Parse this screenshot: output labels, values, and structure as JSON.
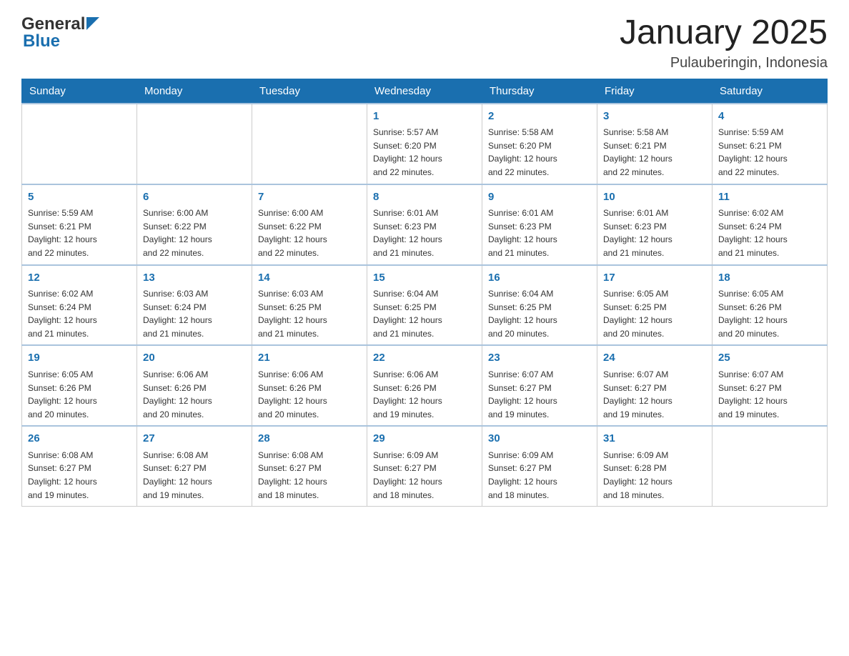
{
  "header": {
    "logo_general": "General",
    "logo_blue": "Blue",
    "title": "January 2025",
    "subtitle": "Pulauberingin, Indonesia"
  },
  "days_of_week": [
    "Sunday",
    "Monday",
    "Tuesday",
    "Wednesday",
    "Thursday",
    "Friday",
    "Saturday"
  ],
  "weeks": [
    [
      {
        "day": "",
        "info": ""
      },
      {
        "day": "",
        "info": ""
      },
      {
        "day": "",
        "info": ""
      },
      {
        "day": "1",
        "info": "Sunrise: 5:57 AM\nSunset: 6:20 PM\nDaylight: 12 hours\nand 22 minutes."
      },
      {
        "day": "2",
        "info": "Sunrise: 5:58 AM\nSunset: 6:20 PM\nDaylight: 12 hours\nand 22 minutes."
      },
      {
        "day": "3",
        "info": "Sunrise: 5:58 AM\nSunset: 6:21 PM\nDaylight: 12 hours\nand 22 minutes."
      },
      {
        "day": "4",
        "info": "Sunrise: 5:59 AM\nSunset: 6:21 PM\nDaylight: 12 hours\nand 22 minutes."
      }
    ],
    [
      {
        "day": "5",
        "info": "Sunrise: 5:59 AM\nSunset: 6:21 PM\nDaylight: 12 hours\nand 22 minutes."
      },
      {
        "day": "6",
        "info": "Sunrise: 6:00 AM\nSunset: 6:22 PM\nDaylight: 12 hours\nand 22 minutes."
      },
      {
        "day": "7",
        "info": "Sunrise: 6:00 AM\nSunset: 6:22 PM\nDaylight: 12 hours\nand 22 minutes."
      },
      {
        "day": "8",
        "info": "Sunrise: 6:01 AM\nSunset: 6:23 PM\nDaylight: 12 hours\nand 21 minutes."
      },
      {
        "day": "9",
        "info": "Sunrise: 6:01 AM\nSunset: 6:23 PM\nDaylight: 12 hours\nand 21 minutes."
      },
      {
        "day": "10",
        "info": "Sunrise: 6:01 AM\nSunset: 6:23 PM\nDaylight: 12 hours\nand 21 minutes."
      },
      {
        "day": "11",
        "info": "Sunrise: 6:02 AM\nSunset: 6:24 PM\nDaylight: 12 hours\nand 21 minutes."
      }
    ],
    [
      {
        "day": "12",
        "info": "Sunrise: 6:02 AM\nSunset: 6:24 PM\nDaylight: 12 hours\nand 21 minutes."
      },
      {
        "day": "13",
        "info": "Sunrise: 6:03 AM\nSunset: 6:24 PM\nDaylight: 12 hours\nand 21 minutes."
      },
      {
        "day": "14",
        "info": "Sunrise: 6:03 AM\nSunset: 6:25 PM\nDaylight: 12 hours\nand 21 minutes."
      },
      {
        "day": "15",
        "info": "Sunrise: 6:04 AM\nSunset: 6:25 PM\nDaylight: 12 hours\nand 21 minutes."
      },
      {
        "day": "16",
        "info": "Sunrise: 6:04 AM\nSunset: 6:25 PM\nDaylight: 12 hours\nand 20 minutes."
      },
      {
        "day": "17",
        "info": "Sunrise: 6:05 AM\nSunset: 6:25 PM\nDaylight: 12 hours\nand 20 minutes."
      },
      {
        "day": "18",
        "info": "Sunrise: 6:05 AM\nSunset: 6:26 PM\nDaylight: 12 hours\nand 20 minutes."
      }
    ],
    [
      {
        "day": "19",
        "info": "Sunrise: 6:05 AM\nSunset: 6:26 PM\nDaylight: 12 hours\nand 20 minutes."
      },
      {
        "day": "20",
        "info": "Sunrise: 6:06 AM\nSunset: 6:26 PM\nDaylight: 12 hours\nand 20 minutes."
      },
      {
        "day": "21",
        "info": "Sunrise: 6:06 AM\nSunset: 6:26 PM\nDaylight: 12 hours\nand 20 minutes."
      },
      {
        "day": "22",
        "info": "Sunrise: 6:06 AM\nSunset: 6:26 PM\nDaylight: 12 hours\nand 19 minutes."
      },
      {
        "day": "23",
        "info": "Sunrise: 6:07 AM\nSunset: 6:27 PM\nDaylight: 12 hours\nand 19 minutes."
      },
      {
        "day": "24",
        "info": "Sunrise: 6:07 AM\nSunset: 6:27 PM\nDaylight: 12 hours\nand 19 minutes."
      },
      {
        "day": "25",
        "info": "Sunrise: 6:07 AM\nSunset: 6:27 PM\nDaylight: 12 hours\nand 19 minutes."
      }
    ],
    [
      {
        "day": "26",
        "info": "Sunrise: 6:08 AM\nSunset: 6:27 PM\nDaylight: 12 hours\nand 19 minutes."
      },
      {
        "day": "27",
        "info": "Sunrise: 6:08 AM\nSunset: 6:27 PM\nDaylight: 12 hours\nand 19 minutes."
      },
      {
        "day": "28",
        "info": "Sunrise: 6:08 AM\nSunset: 6:27 PM\nDaylight: 12 hours\nand 18 minutes."
      },
      {
        "day": "29",
        "info": "Sunrise: 6:09 AM\nSunset: 6:27 PM\nDaylight: 12 hours\nand 18 minutes."
      },
      {
        "day": "30",
        "info": "Sunrise: 6:09 AM\nSunset: 6:27 PM\nDaylight: 12 hours\nand 18 minutes."
      },
      {
        "day": "31",
        "info": "Sunrise: 6:09 AM\nSunset: 6:28 PM\nDaylight: 12 hours\nand 18 minutes."
      },
      {
        "day": "",
        "info": ""
      }
    ]
  ]
}
